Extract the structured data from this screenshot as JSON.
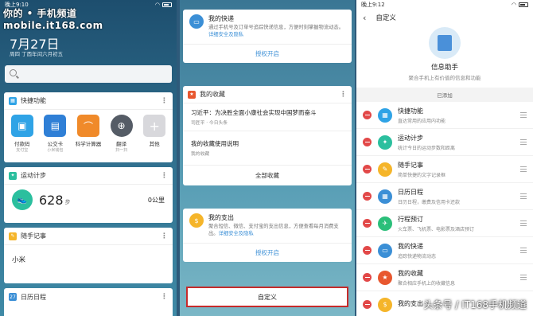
{
  "watermark_top": "你的 • 手机频道 mobile.it168.com",
  "watermark_bottom": "头条号 / IT168手机频道",
  "panel1": {
    "status_time": "晚上9:10",
    "date": "7月27日",
    "date_sub": "周四 丁酉年闰六月初五",
    "quick": {
      "title": "快捷功能",
      "tiles": [
        {
          "label": "付款码",
          "sub": "支付宝",
          "icon": "qr-icon",
          "color": "#2fa3e6"
        },
        {
          "label": "公交卡",
          "sub": "小米钱包",
          "icon": "bus-card-icon",
          "color": "#2f7fd6"
        },
        {
          "label": "科学计算器",
          "sub": "",
          "icon": "calculator-icon",
          "color": "#f08a2a"
        },
        {
          "label": "翻译",
          "sub": "扫一扫",
          "icon": "translate-icon",
          "color": "#555c66"
        },
        {
          "label": "其他",
          "sub": "",
          "icon": "plus-icon",
          "color": "#d8d8dc"
        }
      ]
    },
    "steps": {
      "title": "运动计步",
      "count": "628",
      "unit": "步",
      "distance": "0公里"
    },
    "notes": {
      "title": "随手记事",
      "text": "小米"
    },
    "calendar": {
      "title": "日历日程",
      "icon_num": "27"
    }
  },
  "panel2": {
    "delivery": {
      "title": "我的快递",
      "desc": "通过手机号及订单号追踪快递信息，方便时刻掌握物流动态。",
      "link": "详细安全及隐私",
      "auth": "授权开启"
    },
    "favorites": {
      "title": "我的收藏",
      "items": [
        {
          "title": "习近平：为决胜全面小康社会实现中国梦而奋斗",
          "src": "司匠平 · 今日头条"
        },
        {
          "title": "我的收藏使用说明",
          "src": "我的收藏"
        }
      ],
      "all": "全部收藏"
    },
    "expense": {
      "title": "我的支出",
      "desc": "聚合短信、微信、支付宝的支出信息，方便查看每月消费支出。",
      "link": "详细安全及隐私",
      "auth": "授权开启"
    },
    "custom_btn": "自定义"
  },
  "panel3": {
    "status_time": "晚上9:12",
    "nav_title": "自定义",
    "hero_title": "信息助手",
    "hero_desc": "聚合手机上有价值的信息和功能",
    "added_label": "已添加",
    "rows": [
      {
        "title": "快捷功能",
        "desc": "直达常用的应用内功能",
        "icon": "quick-icon",
        "color": "#2fa3e6"
      },
      {
        "title": "运动计步",
        "desc": "统计今日的运动步数和距离",
        "icon": "run-icon",
        "color": "#2bbf9e"
      },
      {
        "title": "随手记事",
        "desc": "简单快捷的文字记录框",
        "icon": "pencil-icon",
        "color": "#f5b52a"
      },
      {
        "title": "日历日程",
        "desc": "日历日程，缴费及信用卡还款",
        "icon": "calendar-icon",
        "color": "#3b8fd6"
      },
      {
        "title": "行程预订",
        "desc": "火车票、飞机票、电影票及酒店预订",
        "icon": "trip-icon",
        "color": "#2bbf7a"
      },
      {
        "title": "我的快递",
        "desc": "追踪快递物流动态",
        "icon": "box-icon",
        "color": "#3b8fd6"
      },
      {
        "title": "我的收藏",
        "desc": "聚合相应手机上的收藏信息",
        "icon": "star-icon",
        "color": "#e8572f"
      },
      {
        "title": "我的支出",
        "desc": "",
        "icon": "coin-icon",
        "color": "#f5b52a"
      }
    ]
  }
}
